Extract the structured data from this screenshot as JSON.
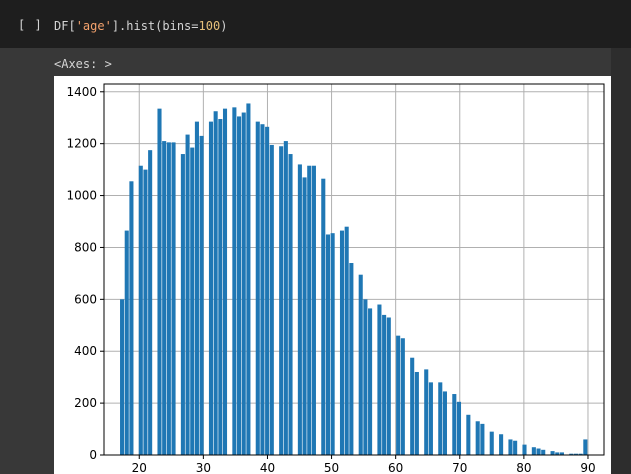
{
  "cell": {
    "run_indicator": "[ ]",
    "code": {
      "prefix": "DF[",
      "string": "'age'",
      "middle": "].hist(bins=",
      "number": "100",
      "suffix": ")"
    }
  },
  "output": {
    "label": "<Axes: >"
  },
  "chart_data": {
    "type": "bar",
    "xlim": [
      14.5,
      92.5
    ],
    "ylim": [
      0,
      1430
    ],
    "x_ticks": [
      20,
      30,
      40,
      50,
      60,
      70,
      80,
      90
    ],
    "y_ticks": [
      0,
      200,
      400,
      600,
      800,
      1000,
      1200,
      1400
    ],
    "grid": true,
    "bin_width": 0.73,
    "bin_edges_start": 17,
    "values": [
      600,
      865,
      1055,
      0,
      1115,
      1100,
      1175,
      0,
      1335,
      1210,
      1205,
      1205,
      0,
      1160,
      1235,
      1185,
      1285,
      1230,
      0,
      1285,
      1325,
      1295,
      1335,
      0,
      1340,
      1305,
      1320,
      1355,
      0,
      1285,
      1275,
      1265,
      1195,
      0,
      1190,
      1210,
      1160,
      0,
      1120,
      1070,
      1115,
      1115,
      0,
      1065,
      850,
      855,
      0,
      865,
      880,
      740,
      0,
      695,
      600,
      565,
      0,
      580,
      540,
      530,
      0,
      460,
      450,
      0,
      375,
      320,
      0,
      330,
      280,
      0,
      280,
      245,
      0,
      235,
      205,
      0,
      155,
      0,
      130,
      120,
      0,
      90,
      0,
      80,
      0,
      60,
      55,
      0,
      40,
      0,
      30,
      25,
      20,
      0,
      15,
      10,
      10,
      0,
      5,
      5,
      5,
      60
    ]
  }
}
